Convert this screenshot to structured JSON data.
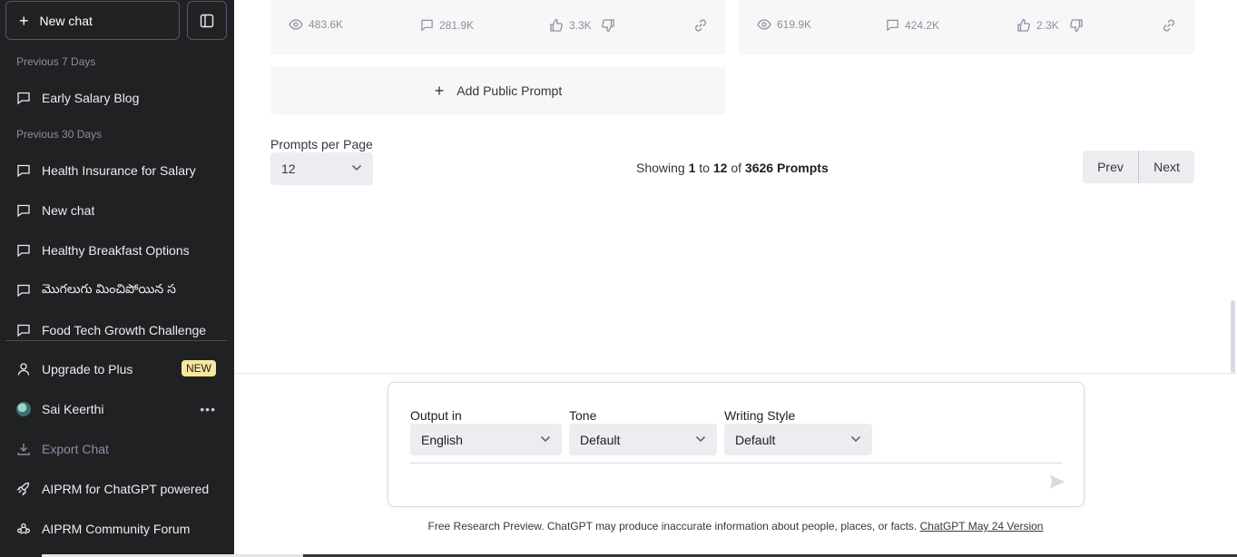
{
  "sidebar": {
    "new_chat_label": "New chat",
    "section_7_days": "Previous 7 Days",
    "section_30_days": "Previous 30 Days",
    "chats_7_days": [
      "Early Salary Blog"
    ],
    "chats_30_days": [
      "Health Insurance for Salary",
      "New chat",
      "Healthy Breakfast Options",
      "మొగలుగు మించిపోయిన స",
      "Food Tech Growth Challenge"
    ],
    "upgrade_label": "Upgrade to Plus",
    "upgrade_badge": "NEW",
    "user_name": "Sai Keerthi",
    "export_label": "Export Chat",
    "aiprm_label": "AIPRM for ChatGPT powered",
    "community_label": "AIPRM Community Forum"
  },
  "cards": [
    {
      "views": "483.6K",
      "comments": "281.9K",
      "likes": "3.3K"
    },
    {
      "views": "619.9K",
      "comments": "424.2K",
      "likes": "2.3K"
    }
  ],
  "add_prompt_label": "Add Public Prompt",
  "pagination": {
    "per_page_label": "Prompts per Page",
    "per_page_value": "12",
    "showing_prefix": "Showing",
    "from": "1",
    "to_word": "to",
    "to": "12",
    "of_word": "of",
    "total": "3626 Prompts",
    "prev_label": "Prev",
    "next_label": "Next"
  },
  "composer": {
    "output_label": "Output in",
    "output_value": "English",
    "tone_label": "Tone",
    "tone_value": "Default",
    "style_label": "Writing Style",
    "style_value": "Default"
  },
  "footer": {
    "text": "Free Research Preview. ChatGPT may produce inaccurate information about people, places, or facts. ",
    "version_link": "ChatGPT May 24 Version"
  }
}
